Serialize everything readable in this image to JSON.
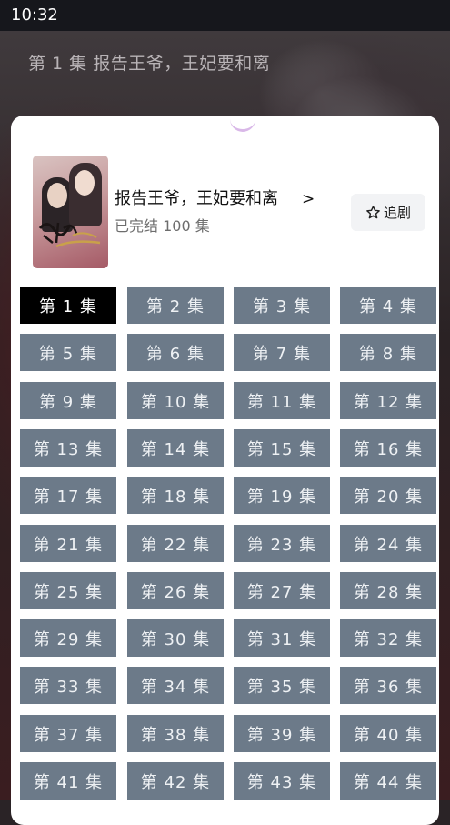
{
  "status_bar": {
    "time": "10:32"
  },
  "video": {
    "episode_heading": "第 1 集 报告王爷，王妃要和离"
  },
  "sheet": {
    "drama": {
      "title": "报告王爷，王妃要和离",
      "chevron": ">",
      "status": "已完结  100 集",
      "poster_icon": "drama-poster-image"
    },
    "follow_button": {
      "label": "追剧",
      "icon": "star-outline-icon"
    },
    "episodes": [
      {
        "label": "第 1 集",
        "selected": true
      },
      {
        "label": "第 2 集",
        "selected": false
      },
      {
        "label": "第 3 集",
        "selected": false
      },
      {
        "label": "第 4 集",
        "selected": false
      },
      {
        "label": "第 5 集",
        "selected": false
      },
      {
        "label": "第 6 集",
        "selected": false
      },
      {
        "label": "第 7 集",
        "selected": false
      },
      {
        "label": "第 8 集",
        "selected": false
      },
      {
        "label": "第 9 集",
        "selected": false
      },
      {
        "label": "第 10 集",
        "selected": false
      },
      {
        "label": "第 11 集",
        "selected": false
      },
      {
        "label": "第 12 集",
        "selected": false
      },
      {
        "label": "第 13 集",
        "selected": false
      },
      {
        "label": "第 14 集",
        "selected": false
      },
      {
        "label": "第 15 集",
        "selected": false
      },
      {
        "label": "第 16 集",
        "selected": false
      },
      {
        "label": "第 17 集",
        "selected": false
      },
      {
        "label": "第 18 集",
        "selected": false
      },
      {
        "label": "第 19 集",
        "selected": false
      },
      {
        "label": "第 20 集",
        "selected": false
      },
      {
        "label": "第 21 集",
        "selected": false
      },
      {
        "label": "第 22 集",
        "selected": false
      },
      {
        "label": "第 23 集",
        "selected": false
      },
      {
        "label": "第 24 集",
        "selected": false
      },
      {
        "label": "第 25 集",
        "selected": false
      },
      {
        "label": "第 26 集",
        "selected": false
      },
      {
        "label": "第 27 集",
        "selected": false
      },
      {
        "label": "第 28 集",
        "selected": false
      },
      {
        "label": "第 29 集",
        "selected": false
      },
      {
        "label": "第 30 集",
        "selected": false
      },
      {
        "label": "第 31 集",
        "selected": false
      },
      {
        "label": "第 32 集",
        "selected": false
      },
      {
        "label": "第 33 集",
        "selected": false
      },
      {
        "label": "第 34 集",
        "selected": false
      },
      {
        "label": "第 35 集",
        "selected": false
      },
      {
        "label": "第 36 集",
        "selected": false
      },
      {
        "label": "第 37 集",
        "selected": false
      },
      {
        "label": "第 38 集",
        "selected": false
      },
      {
        "label": "第 39 集",
        "selected": false
      },
      {
        "label": "第 40 集",
        "selected": false
      },
      {
        "label": "第 41 集",
        "selected": false
      },
      {
        "label": "第 42 集",
        "selected": false
      },
      {
        "label": "第 43 集",
        "selected": false
      },
      {
        "label": "第 44 集",
        "selected": false
      }
    ]
  },
  "colors": {
    "episode_bg": "#6c7a89",
    "episode_active_bg": "#000000",
    "sheet_bg": "#ffffff",
    "status_bar_bg": "#16171c"
  }
}
